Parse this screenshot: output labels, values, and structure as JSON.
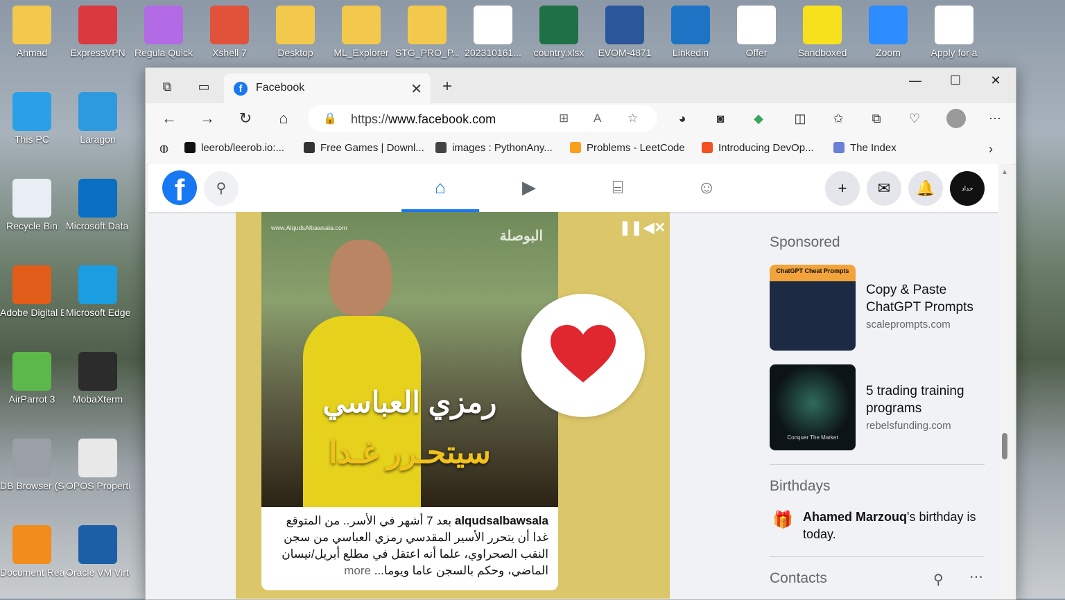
{
  "desktop": {
    "icons": [
      {
        "label": "Ahmad",
        "icon": "user-folder-icon",
        "color": "#f2c94c",
        "col": 0,
        "row": 0
      },
      {
        "label": "ExpressVPN",
        "icon": "expressvpn-icon",
        "color": "#da3940",
        "col": 1,
        "row": 0
      },
      {
        "label": "Regula Quick",
        "icon": "regula-icon",
        "color": "#b36be5",
        "col": 2,
        "row": 0
      },
      {
        "label": "Xshell 7",
        "icon": "xshell-icon",
        "color": "#e0533a",
        "col": 3,
        "row": 0
      },
      {
        "label": "Desktop",
        "icon": "folder-icon",
        "color": "#f2c94c",
        "col": 4,
        "row": 0
      },
      {
        "label": "ML_Explorer",
        "icon": "folder-icon",
        "color": "#f2c94c",
        "col": 5,
        "row": 0
      },
      {
        "label": "STG_PRO_P...",
        "icon": "folder-icon",
        "color": "#f2c94c",
        "col": 6,
        "row": 0
      },
      {
        "label": "202310161...",
        "icon": "pdf-icon",
        "color": "#ffffff",
        "col": 7,
        "row": 0
      },
      {
        "label": "country.xlsx",
        "icon": "excel-icon",
        "color": "#1e7145",
        "col": 8,
        "row": 0
      },
      {
        "label": "EVOM-4871",
        "icon": "word-icon",
        "color": "#2b579a",
        "col": 9,
        "row": 0
      },
      {
        "label": "Linkedin",
        "icon": "video-shortcut-icon",
        "color": "#1e74c4",
        "col": 10,
        "row": 0
      },
      {
        "label": "Offer",
        "icon": "pdf-icon",
        "color": "#ffffff",
        "col": 11,
        "row": 0
      },
      {
        "label": "Sandboxed",
        "icon": "sandboxie-icon",
        "color": "#f7e11c",
        "col": 12,
        "row": 0
      },
      {
        "label": "Zoom",
        "icon": "zoom-icon",
        "color": "#2d8cff",
        "col": 13,
        "row": 0
      },
      {
        "label": "Apply for a",
        "icon": "pdf-icon",
        "color": "#ffffff",
        "col": 14,
        "row": 0
      },
      {
        "label": "This PC",
        "icon": "monitor-icon",
        "color": "#2aa0e8",
        "col": 0,
        "row": 1
      },
      {
        "label": "Laragon",
        "icon": "elephant-icon",
        "color": "#2d9ae0",
        "col": 1,
        "row": 1
      },
      {
        "label": "Recycle Bin",
        "icon": "recycle-bin-icon",
        "color": "#e8eef4",
        "col": 0,
        "row": 2
      },
      {
        "label": "Microsoft Data Mi...",
        "icon": "data-migration-icon",
        "color": "#0a6fc2",
        "col": 1,
        "row": 2
      },
      {
        "label": "Adobe Digital Ed...",
        "icon": "adobe-de-icon",
        "color": "#e25c1a",
        "col": 0,
        "row": 3
      },
      {
        "label": "Microsoft Edge",
        "icon": "edge-icon",
        "color": "#1b9de2",
        "col": 1,
        "row": 3
      },
      {
        "label": "AirParrot 3",
        "icon": "airparrot-icon",
        "color": "#5cb84a",
        "col": 0,
        "row": 4
      },
      {
        "label": "MobaXterm",
        "icon": "terminal-icon",
        "color": "#2c2c2c",
        "col": 1,
        "row": 4
      },
      {
        "label": "DB Browser (SQLite)",
        "icon": "database-icon",
        "color": "#9aa0a6",
        "col": 0,
        "row": 5
      },
      {
        "label": "OPOS Properti...",
        "icon": "opos-icon",
        "color": "#e8e8e8",
        "col": 1,
        "row": 5
      },
      {
        "label": "Document Reader",
        "icon": "document-reader-icon",
        "color": "#f28c1b",
        "col": 0,
        "row": 6
      },
      {
        "label": "Oracle VM VirtualBox",
        "icon": "virtualbox-icon",
        "color": "#1d5fa6",
        "col": 1,
        "row": 6
      }
    ]
  },
  "browser": {
    "tab": {
      "title": "Facebook",
      "favicon": "facebook-icon"
    },
    "url": {
      "prefix": "https://",
      "host": "www.facebook.com"
    },
    "bookmarks": [
      {
        "label": "leerob/leerob.io:...",
        "icon": "github-icon",
        "color": "#111111"
      },
      {
        "label": "Free Games | Downl...",
        "icon": "epic-games-icon",
        "color": "#333333"
      },
      {
        "label": "images : PythonAny...",
        "icon": "pythonanywhere-icon",
        "color": "#444444"
      },
      {
        "label": "Problems - LeetCode",
        "icon": "leetcode-icon",
        "color": "#f89f1b"
      },
      {
        "label": "Introducing DevOp...",
        "icon": "microsoft-icon",
        "color": "#f25022"
      },
      {
        "label": "The Index",
        "icon": "index-icon",
        "color": "#6a7fd8"
      }
    ]
  },
  "facebook": {
    "avatar_text": "حداد",
    "post": {
      "watermark": "www.AlqudsAlbawsala.com",
      "brand": "البوصلة",
      "headline": "رمزي العباسي",
      "subheadline": "سيتحـرر غـدا",
      "user": "alqudsalbawsala",
      "text": "بعد 7 أشهر في الأسر.. من المتوقع غدا أن يتحرر الأسير المقدسي رمزي العباسي من سجن النقب الصحراوي، علما أنه اعتقل في مطلع أبريل/نيسان الماضي، وحكم بالسجن عاما ويوما...",
      "more": "more"
    },
    "sponsored": {
      "heading": "Sponsored",
      "ads": [
        {
          "title": "Copy & Paste ChatGPT Prompts",
          "url": "scaleprompts.com",
          "thumb_text": "ChatGPT Cheat Prompts",
          "thumb_color": "#f2a33a"
        },
        {
          "title": "5 trading training programs",
          "url": "rebelsfunding.com",
          "thumb_text": "Conquer The Market",
          "thumb_color": "#101820"
        }
      ]
    },
    "birthdays": {
      "heading": "Birthdays",
      "name": "Ahamed Marzouq",
      "suffix": "'s birthday is today."
    },
    "contacts": {
      "heading": "Contacts"
    }
  }
}
